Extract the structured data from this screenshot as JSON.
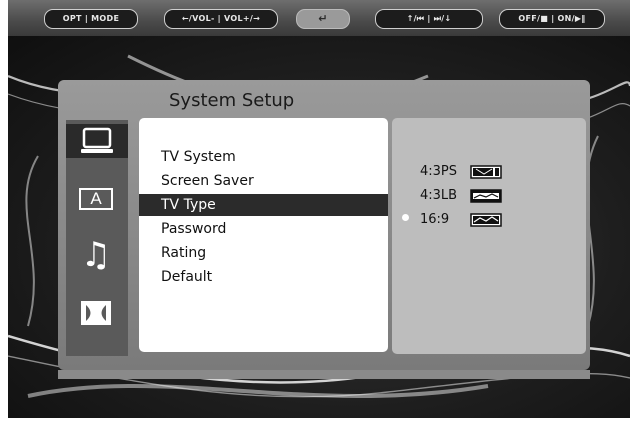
{
  "remote": {
    "buttons": [
      {
        "label": "OPT | MODE"
      },
      {
        "label": "←/VOL- | VOL+/→"
      },
      {
        "label": "↵"
      },
      {
        "label": "↑/⏮ | ⏭/↓"
      },
      {
        "label": "OFF/■ | ON/▶‖"
      }
    ]
  },
  "panel": {
    "title": "System Setup",
    "tabs": [
      {
        "icon": "tv-icon",
        "active": true
      },
      {
        "icon": "language-a-icon",
        "glyph": "A",
        "active": false
      },
      {
        "icon": "music-note-icon",
        "glyph": "♫",
        "active": false
      },
      {
        "icon": "dolby-icon",
        "active": false
      }
    ],
    "menu": [
      {
        "label": "TV System"
      },
      {
        "label": "Screen Saver"
      },
      {
        "label": "TV Type",
        "selected": true
      },
      {
        "label": "Password"
      },
      {
        "label": "Rating"
      },
      {
        "label": "Default"
      }
    ],
    "options": [
      {
        "label": "4:3PS",
        "icon": "aspect-ps-icon"
      },
      {
        "label": "4:3LB",
        "icon": "aspect-lb-icon"
      },
      {
        "label": "16:9",
        "icon": "aspect-wide-icon",
        "current": true
      }
    ]
  }
}
